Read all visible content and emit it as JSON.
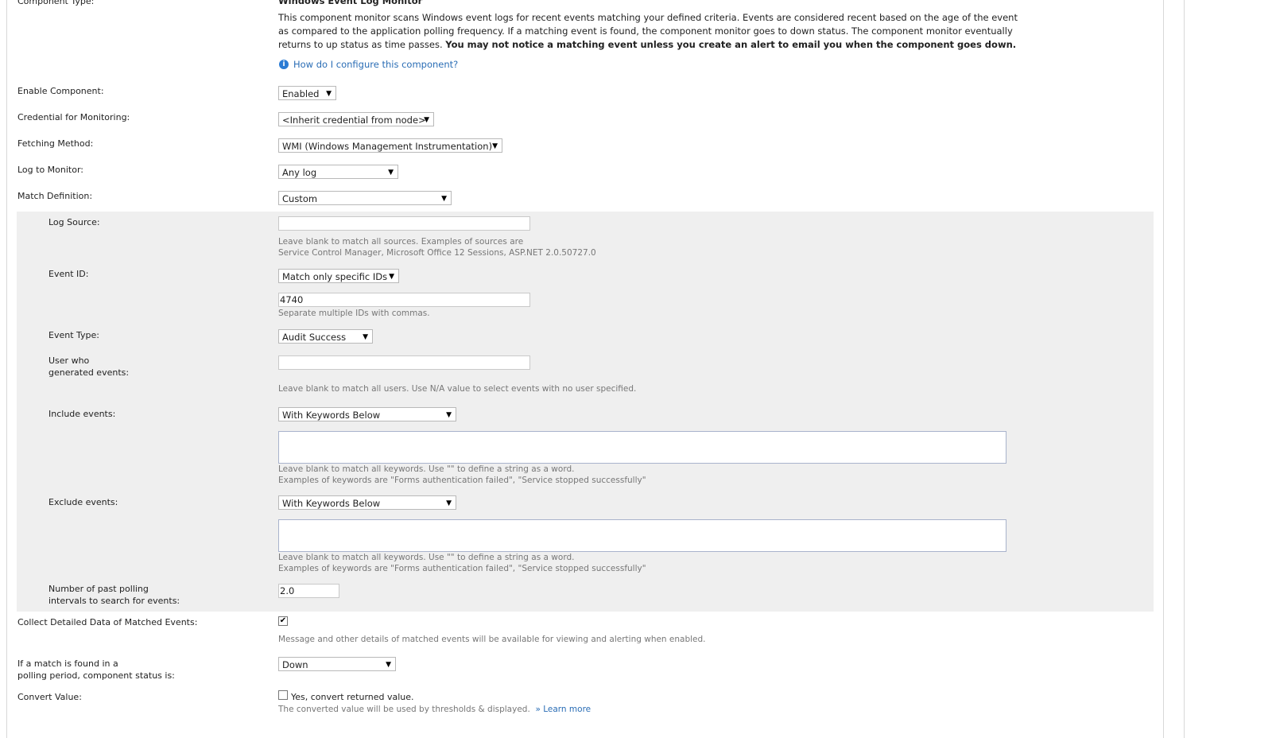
{
  "component_type": {
    "label": "Component Type:",
    "name": "Windows Event Log Monitor",
    "description": "This component monitor scans Windows event logs for recent events matching your defined criteria. Events are considered recent based on the age of the event as compared to the application polling frequency. If a matching event is found, the component monitor goes to down status. The component monitor eventually returns to up status as time passes.",
    "description_bold": "You may not notice a matching event unless you create an alert to email you when the component goes down.",
    "help_link": "How do I configure this component?"
  },
  "enable_component": {
    "label": "Enable Component:",
    "value": "Enabled"
  },
  "credential": {
    "label": "Credential for Monitoring:",
    "value": "<Inherit credential from node>"
  },
  "fetching_method": {
    "label": "Fetching Method:",
    "value": "WMI (Windows Management Instrumentation)"
  },
  "log_to_monitor": {
    "label": "Log to Monitor:",
    "value": "Any log"
  },
  "match_definition": {
    "label": "Match Definition:",
    "value": "Custom"
  },
  "log_source": {
    "label": "Log Source:",
    "value": "",
    "hint1": "Leave blank to match all sources. Examples of sources are",
    "hint2": "Service Control Manager, Microsoft Office 12 Sessions, ASP.NET 2.0.50727.0"
  },
  "event_id": {
    "label": "Event ID:",
    "mode": "Match only specific IDs",
    "value": "4740",
    "hint": "Separate multiple IDs with commas."
  },
  "event_type": {
    "label": "Event Type:",
    "value": "Audit Success"
  },
  "user_generated": {
    "label1": "User who",
    "label2": "generated events:",
    "value": "",
    "hint": "Leave blank to match all users. Use N/A value to select events with no user specified."
  },
  "include_events": {
    "label": "Include events:",
    "value": "With Keywords Below",
    "hint1": "Leave blank to match all keywords. Use \"\" to define a string as a word.",
    "hint2": "Examples of keywords are \"Forms authentication failed\", \"Service stopped successfully\""
  },
  "exclude_events": {
    "label": "Exclude events:",
    "value": "With Keywords Below",
    "hint1": "Leave blank to match all keywords. Use \"\" to define a string as a word.",
    "hint2": "Examples of keywords are \"Forms authentication failed\", \"Service stopped successfully\""
  },
  "past_intervals": {
    "label1": "Number of past polling",
    "label2": "intervals to search for events:",
    "value": "2.0"
  },
  "collect_detailed": {
    "label": "Collect Detailed Data of Matched Events:",
    "checked": true,
    "hint": "Message and other details of matched events will be available for viewing and alerting when enabled."
  },
  "match_status": {
    "label1": "If a match is found in a",
    "label2": "polling period, component status is:",
    "value": "Down"
  },
  "convert_value": {
    "label": "Convert Value:",
    "checked": false,
    "checkbox_label": "Yes, convert returned value.",
    "hint": "The converted value will be used by thresholds & displayed.",
    "learn_more": "» Learn more"
  }
}
